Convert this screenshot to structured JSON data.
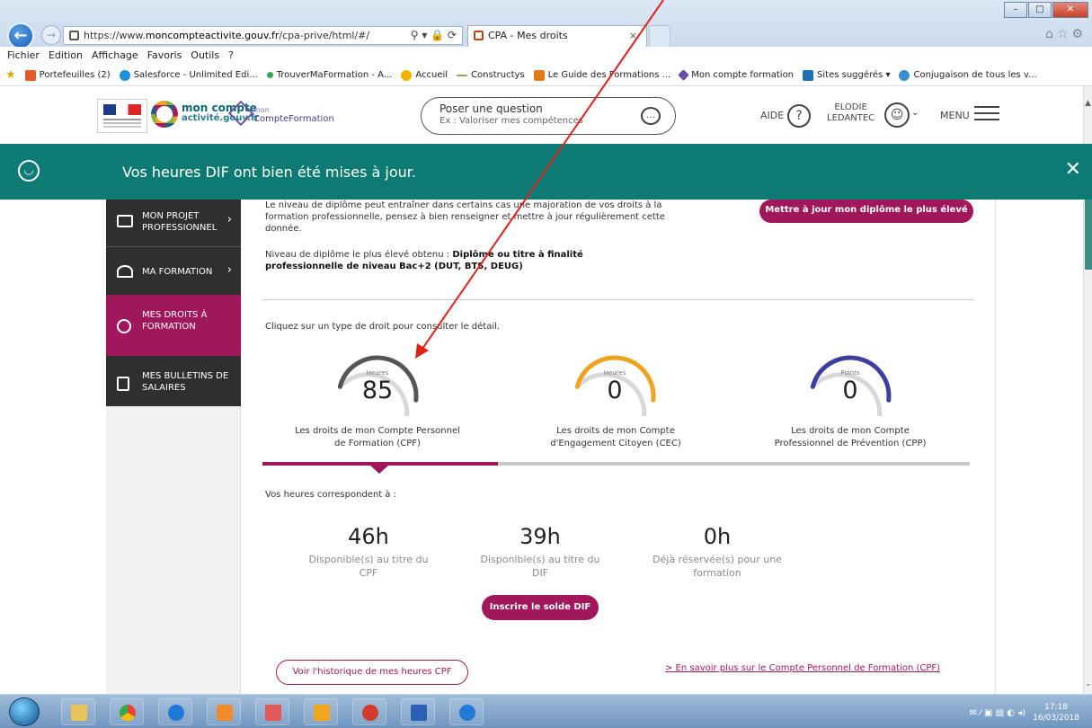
{
  "browser": {
    "url_prefix": "https://www.",
    "url_host": "moncompteactivite.gouv.fr",
    "url_path": "/cpa-prive/html/#/",
    "tab_title": "CPA - Mes droits",
    "tab_close": "×",
    "addr_tools": "⚲ ▾ 🔒 ⟳"
  },
  "menubar": [
    "Fichier",
    "Edition",
    "Affichage",
    "Favoris",
    "Outils",
    "?"
  ],
  "favorites": [
    {
      "label": "Portefeuilles (2)",
      "color": "#e05a2b"
    },
    {
      "label": "Salesforce - Unlimited Edi...",
      "color": "#1d8fd6"
    },
    {
      "label": "TrouverMaFormation - A...",
      "color": "#34a853"
    },
    {
      "label": "Accueil",
      "color": "#f2b400"
    },
    {
      "label": "Constructys",
      "color": "#9aa34a"
    },
    {
      "label": "Le Guide des Formations ...",
      "color": "#e07a1a"
    },
    {
      "label": "Mon compte formation",
      "color": "#6a4fa8"
    },
    {
      "label": "Sites suggérés ▾",
      "color": "#1d6fb5"
    },
    {
      "label": "Conjugaison de tous les v...",
      "color": "#3b8fd0"
    }
  ],
  "header": {
    "logo_cpa_top": "mon compte",
    "logo_cpa_bottom": "activité.gouv.fr",
    "logo_cf_top": "mon",
    "logo_cf_bottom": "CompteFormation",
    "ask_title": "Poser une question",
    "ask_placeholder": "Ex : Valoriser mes compétences",
    "aide": "AIDE",
    "user_first": "ELODIE",
    "user_last": "LEDANTEC",
    "menu": "MENU"
  },
  "banner": {
    "message": "Vos heures DIF ont bien été mises à jour.",
    "close": "✕"
  },
  "sidebar": {
    "items": [
      {
        "label1": "MON PROJET",
        "label2": "PROFESSIONNEL",
        "chev": "›"
      },
      {
        "label1": "MA FORMATION",
        "label2": "",
        "chev": "›"
      },
      {
        "label1": "MES DROITS À",
        "label2": "FORMATION",
        "chev": ""
      },
      {
        "label1": "MES BULLETINS DE",
        "label2": "SALAIRES",
        "chev": ""
      }
    ]
  },
  "main": {
    "diploma_text": "Le niveau de diplôme peut entraîner dans certains cas une majoration de vos droits à la formation professionnelle, pensez à bien renseigner et mettre à jour régulièrement cette donnée.",
    "diploma_level_label": "Niveau de diplôme le plus élevé obtenu : ",
    "diploma_level_value": "Diplôme ou titre à finalité professionnelle de niveau Bac+2 (DUT, BTS, DEUG)",
    "diploma_button": "Mettre à jour mon diplôme le plus élevé",
    "hint": "Cliquez sur un type de droit pour consulter le détail.",
    "gauges": [
      {
        "unit": "Heures",
        "value": "85",
        "caption1": "Les droits de mon Compte Personnel",
        "caption2": "de Formation (CPF)",
        "color": "#555555",
        "fraction": 0.82
      },
      {
        "unit": "Heures",
        "value": "0",
        "caption1": "Les droits de mon Compte",
        "caption2": "d'Engagement Citoyen (CEC)",
        "color": "#f0a21e",
        "fraction": 0.82
      },
      {
        "unit": "Points",
        "value": "0",
        "caption1": "Les droits de mon Compte",
        "caption2": "Professionnel de Prévention (CPP)",
        "color": "#3c3f9e",
        "fraction": 0.82
      }
    ],
    "active_tab_fraction": 0.333,
    "correspond": "Vos heures correspondent à :",
    "stats": [
      {
        "big": "46h",
        "lbl1": "Disponible(s) au titre du",
        "lbl2": "CPF"
      },
      {
        "big": "39h",
        "lbl1": "Disponible(s) au titre du",
        "lbl2": "DIF"
      },
      {
        "big": "0h",
        "lbl1": "Déjà réservée(s) pour une",
        "lbl2": "formation"
      }
    ],
    "dif_button": "Inscrire le solde DIF",
    "history_button": "Voir l'historique de mes heures CPF",
    "learn_more_link": "> En savoir plus sur le Compte Personnel de Formation (CPF)"
  },
  "taskbar": {
    "time": "17:18",
    "date": "16/03/2018"
  }
}
